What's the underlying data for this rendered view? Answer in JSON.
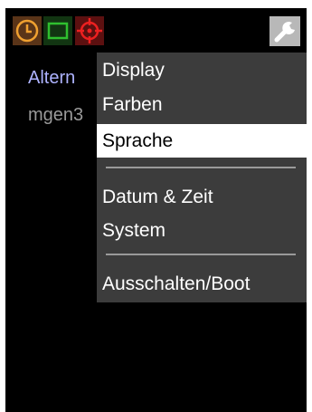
{
  "status_bar": {
    "icons": [
      "clock-icon",
      "rectangle-icon",
      "crosshair-icon"
    ],
    "settings_icon": "wrench-icon"
  },
  "background": {
    "title": "Altern",
    "subtitle": "mgen3"
  },
  "menu": {
    "items": [
      {
        "label": "Display"
      },
      {
        "label": "Farben"
      },
      {
        "label": "Sprache",
        "selected": true
      },
      {
        "label": "Datum & Zeit"
      },
      {
        "label": "System"
      },
      {
        "label": "Ausschalten/Boot"
      }
    ]
  },
  "colors": {
    "clock": "#f0a030",
    "rectangle": "#2fc02f",
    "crosshair": "#ee2020",
    "menu_bg": "#3c3c3c",
    "title_text": "#aeb3ff"
  }
}
